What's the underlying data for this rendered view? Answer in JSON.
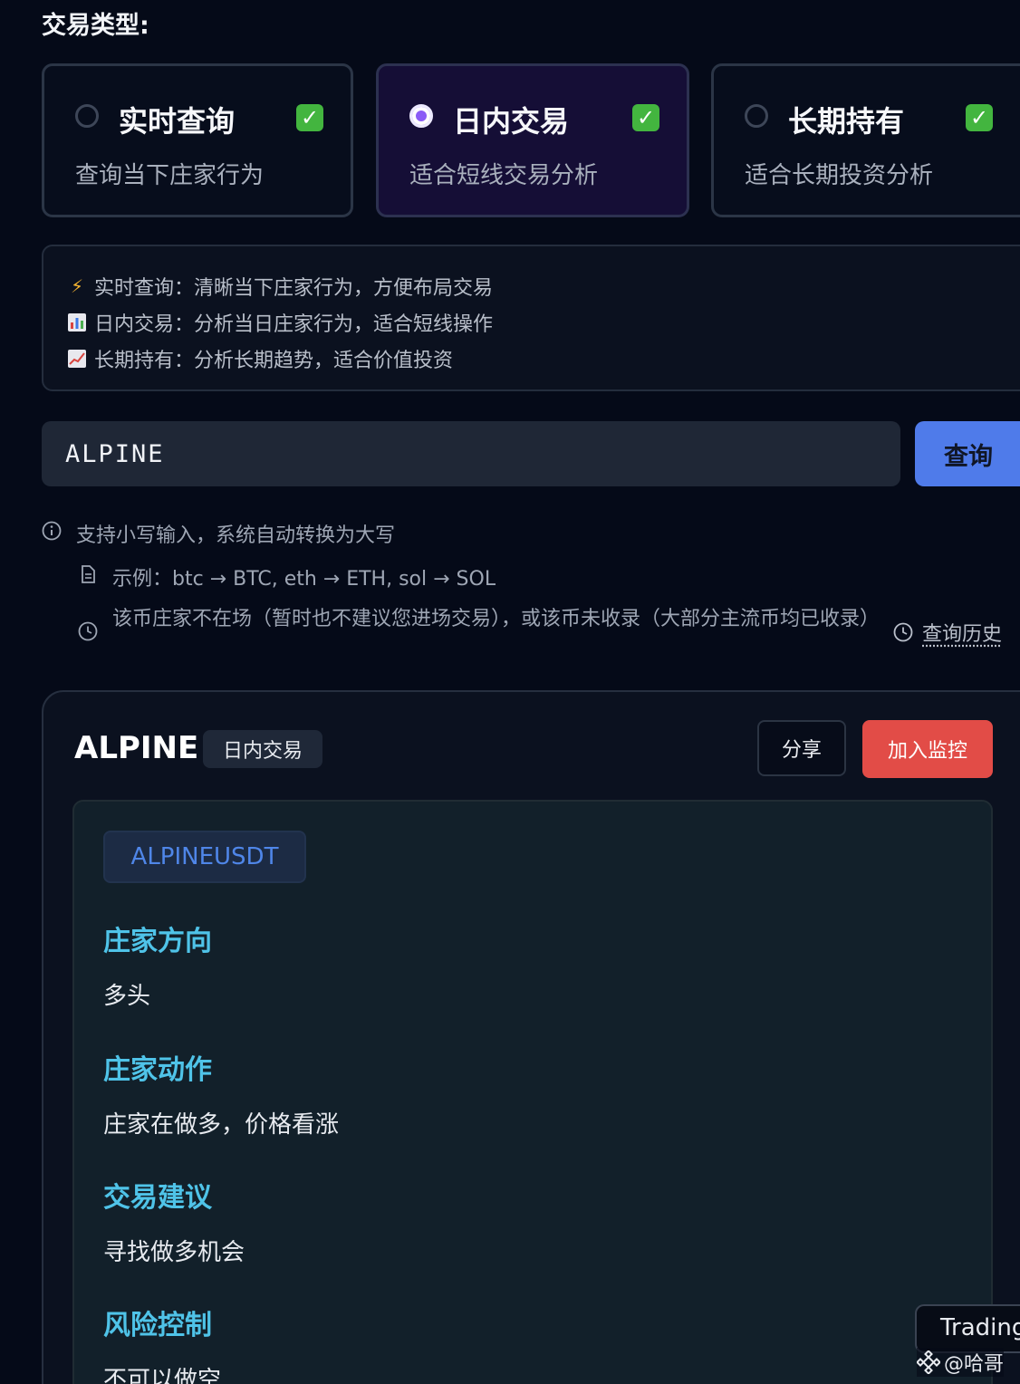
{
  "section_label": "交易类型:",
  "trade_types": [
    {
      "title": "实时查询",
      "desc": "查询当下庄家行为",
      "check": "✓",
      "selected": false
    },
    {
      "title": "日内交易",
      "desc": "适合短线交易分析",
      "check": "✓",
      "selected": true
    },
    {
      "title": "长期持有",
      "desc": "适合长期投资分析",
      "check": "✓",
      "selected": false
    }
  ],
  "info_lines": [
    {
      "icon": "⚡",
      "text": "实时查询：清晰当下庄家行为，方便布局交易"
    },
    {
      "icon": "📊",
      "text": "日内交易：分析当日庄家行为，适合短线操作"
    },
    {
      "icon": "📈",
      "text": "长期持有：分析长期趋势，适合价值投资"
    }
  ],
  "search": {
    "value": "ALPINE",
    "button": "查询"
  },
  "hints": {
    "case_hint": "支持小写输入，系统自动转换为大写",
    "example": "示例：btc → BTC, eth → ETH, sol → SOL",
    "not_found": "该币庄家不在场（暂时也不建议您进场交易），或该币未收录（大部分主流币均已收录）",
    "history": "查询历史"
  },
  "result": {
    "symbol": "ALPINE",
    "mode_tag": "日内交易",
    "share": "分享",
    "monitor": "加入监控",
    "pair": "ALPINEUSDT",
    "sections": [
      {
        "head": "庄家方向",
        "text": "多头"
      },
      {
        "head": "庄家动作",
        "text": "庄家在做多，价格看涨"
      },
      {
        "head": "交易建议",
        "text": "寻找做多机会"
      },
      {
        "head": "风险控制",
        "text": "不可以做空"
      }
    ]
  },
  "floating": {
    "trading": "Trading",
    "watermark": "@哈哥"
  },
  "colors": {
    "accent": "#4f7bea",
    "danger": "#e24c47",
    "section_head": "#4fc3e8",
    "radio_selected": "#8b5cf6"
  }
}
